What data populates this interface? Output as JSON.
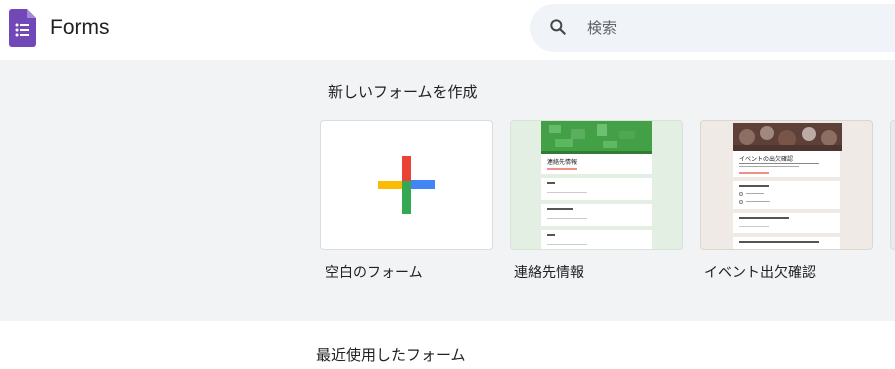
{
  "header": {
    "app_title": "Forms",
    "logo_icon": "google-forms-icon",
    "brand_color": "#7248b9"
  },
  "search": {
    "placeholder": "検索",
    "icon": "search-icon"
  },
  "templates": {
    "section_title": "新しいフォームを作成",
    "items": [
      {
        "label": "空白のフォーム",
        "icon": "plus-icon"
      },
      {
        "label": "連絡先情報",
        "thumb_title": "連絡先情報",
        "accent": "#34a853"
      },
      {
        "label": "イベント出欠確認",
        "thumb_title": "イベントの出欠確認",
        "accent": "#8d6e63"
      }
    ]
  },
  "recent": {
    "section_title": "最近使用したフォーム"
  }
}
